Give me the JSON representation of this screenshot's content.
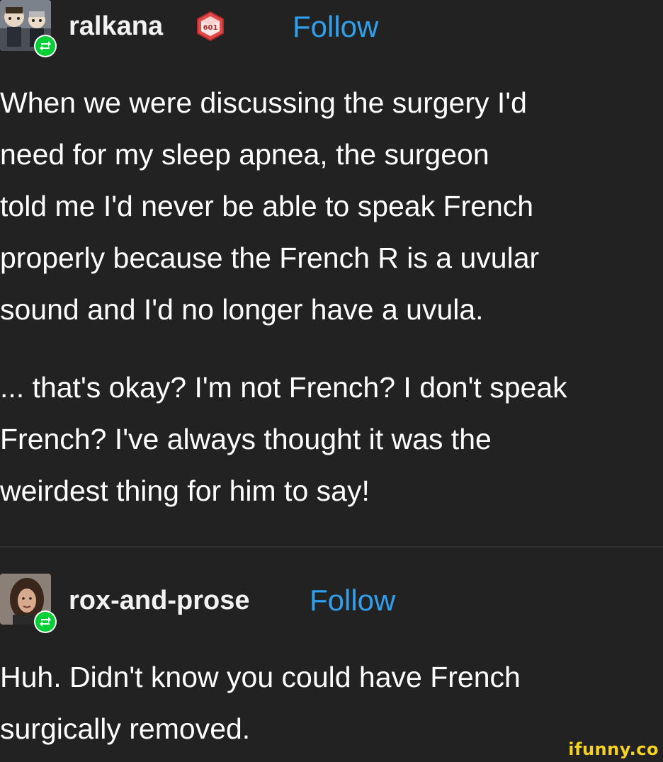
{
  "posts": [
    {
      "username": "ralkana",
      "follow_label": "Follow",
      "badge_icon": "d20-badge-icon",
      "badge_text": "601",
      "avatar_icon": "avatar-figurines",
      "reblog_icon": "reblog-icon",
      "paragraphs": [
        [
          "When we were discussing the surgery I'd",
          "need for my sleep apnea, the surgeon",
          "told me I'd never be able to speak French",
          "properly because the French R is a uvular",
          "sound and I'd no longer have a uvula."
        ],
        [
          "... that's okay? I'm not French? I don't speak",
          "French? I've always thought it was the",
          "weirdest thing for him to say!"
        ]
      ]
    },
    {
      "username": "rox-and-prose",
      "follow_label": "Follow",
      "avatar_icon": "avatar-photo",
      "reblog_icon": "reblog-icon",
      "paragraphs": [
        [
          "Huh. Didn't know you could have French",
          "surgically removed."
        ]
      ]
    }
  ],
  "watermark": "ifunny.co",
  "colors": {
    "background": "#222222",
    "follow": "#2fa0ee",
    "reblog": "#00cf35",
    "watermark": "#f4d21d"
  }
}
